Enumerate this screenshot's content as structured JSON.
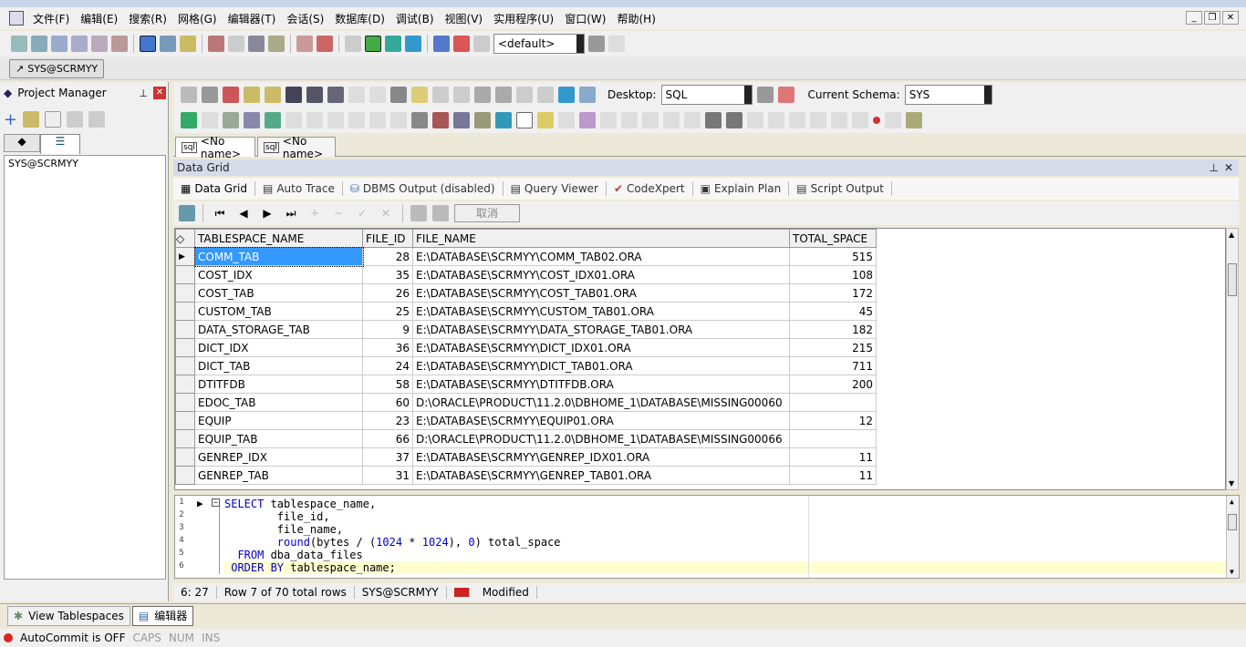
{
  "menu": [
    "文件(F)",
    "编辑(E)",
    "搜索(R)",
    "网格(G)",
    "编辑器(T)",
    "会话(S)",
    "数据库(D)",
    "调试(B)",
    "视图(V)",
    "实用程序(U)",
    "窗口(W)",
    "帮助(H)"
  ],
  "toolbar": {
    "profile_combo": "<default>"
  },
  "connection_tab": "SYS@SCRMYY",
  "project_manager": {
    "title": "Project Manager",
    "tree_item": "SYS@SCRMYY"
  },
  "editor_toolbar": {
    "desktop_label": "Desktop:",
    "desktop_value": "SQL",
    "schema_label": "Current Schema:",
    "schema_value": "SYS"
  },
  "editor_tabs": [
    "<No name>",
    "<No name>"
  ],
  "data_grid": {
    "title": "Data Grid",
    "subtabs": [
      "Data Grid",
      "Auto Trace",
      "DBMS Output (disabled)",
      "Query Viewer",
      "CodeXpert",
      "Explain Plan",
      "Script Output"
    ],
    "cancel_label": "取消",
    "columns": [
      "TABLESPACE_NAME",
      "FILE_ID",
      "FILE_NAME",
      "TOTAL_SPACE"
    ],
    "rows": [
      [
        "COMM_TAB",
        "28",
        "E:\\DATABASE\\SCRMYY\\COMM_TAB02.ORA",
        "515"
      ],
      [
        "COST_IDX",
        "35",
        "E:\\DATABASE\\SCRMYY\\COST_IDX01.ORA",
        "108"
      ],
      [
        "COST_TAB",
        "26",
        "E:\\DATABASE\\SCRMYY\\COST_TAB01.ORA",
        "172"
      ],
      [
        "CUSTOM_TAB",
        "25",
        "E:\\DATABASE\\SCRMYY\\CUSTOM_TAB01.ORA",
        "45"
      ],
      [
        "DATA_STORAGE_TAB",
        "9",
        "E:\\DATABASE\\SCRMYY\\DATA_STORAGE_TAB01.ORA",
        "182"
      ],
      [
        "DICT_IDX",
        "36",
        "E:\\DATABASE\\SCRMYY\\DICT_IDX01.ORA",
        "215"
      ],
      [
        "DICT_TAB",
        "24",
        "E:\\DATABASE\\SCRMYY\\DICT_TAB01.ORA",
        "711"
      ],
      [
        "DTITFDB",
        "58",
        "E:\\DATABASE\\SCRMYY\\DTITFDB.ORA",
        "200"
      ],
      [
        "EDOC_TAB",
        "60",
        "D:\\ORACLE\\PRODUCT\\11.2.0\\DBHOME_1\\DATABASE\\MISSING00060",
        ""
      ],
      [
        "EQUIP",
        "23",
        "E:\\DATABASE\\SCRMYY\\EQUIP01.ORA",
        "12"
      ],
      [
        "EQUIP_TAB",
        "66",
        "D:\\ORACLE\\PRODUCT\\11.2.0\\DBHOME_1\\DATABASE\\MISSING00066",
        ""
      ],
      [
        "GENREP_IDX",
        "37",
        "E:\\DATABASE\\SCRMYY\\GENREP_IDX01.ORA",
        "11"
      ],
      [
        "GENREP_TAB",
        "31",
        "E:\\DATABASE\\SCRMYY\\GENREP_TAB01.ORA",
        "11"
      ]
    ]
  },
  "sql_lines": [
    "1",
    "2",
    "3",
    "4",
    "5",
    "6"
  ],
  "status": {
    "position": "6: 27",
    "rows": "Row 7 of 70 total rows",
    "connection": "SYS@SCRMYY",
    "state": "Modified"
  },
  "bottom_tabs": [
    "View Tablespaces",
    "编辑器"
  ],
  "bottom_status": {
    "autocommit": "AutoCommit is OFF",
    "caps": "CAPS",
    "num": "NUM",
    "ins": "INS"
  }
}
